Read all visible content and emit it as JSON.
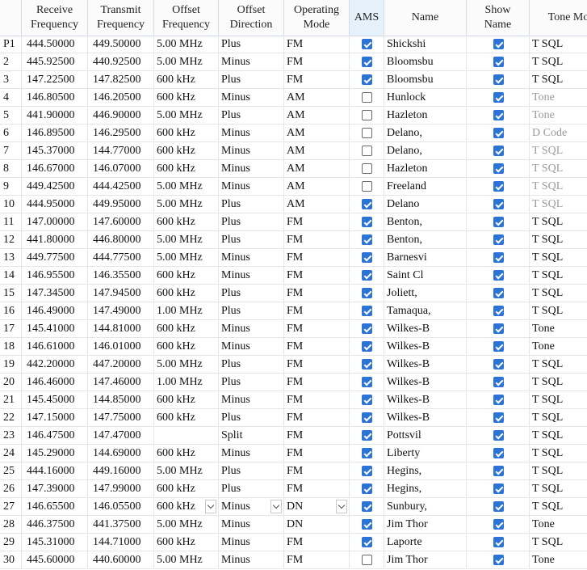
{
  "columns": [
    {
      "key": "row",
      "label": ""
    },
    {
      "key": "rx",
      "label": "Receive\nFrequency"
    },
    {
      "key": "tx",
      "label": "Transmit\nFrequency"
    },
    {
      "key": "off",
      "label": "Offset\nFrequency"
    },
    {
      "key": "dir",
      "label": "Offset\nDirection"
    },
    {
      "key": "mode",
      "label": "Operating\nMode"
    },
    {
      "key": "ams",
      "label": "AMS"
    },
    {
      "key": "name",
      "label": "Name"
    },
    {
      "key": "show",
      "label": "Show\nName"
    },
    {
      "key": "tone",
      "label": "Tone Mod"
    }
  ],
  "colors": {
    "accent": "#2b74d6",
    "header_bg": "#fbfbfb",
    "ams_header_bg": "#e5f1fb",
    "dim_text": "#9a9a9a"
  },
  "rows": [
    {
      "row": "P1",
      "rx": "444.50000",
      "tx": "449.50000",
      "off": "5.00 MHz",
      "dir": "Plus",
      "mode": "FM",
      "ams": true,
      "name": "Shickshi",
      "show": true,
      "tone": "T SQL",
      "tone_dim": false
    },
    {
      "row": "2",
      "rx": "445.92500",
      "tx": "440.92500",
      "off": "5.00 MHz",
      "dir": "Minus",
      "mode": "FM",
      "ams": true,
      "name": "Bloomsbu",
      "show": true,
      "tone": "T SQL",
      "tone_dim": false
    },
    {
      "row": "3",
      "rx": "147.22500",
      "tx": "147.82500",
      "off": "600 kHz",
      "dir": "Plus",
      "mode": "FM",
      "ams": true,
      "name": "Bloomsbu",
      "show": true,
      "tone": "T SQL",
      "tone_dim": false
    },
    {
      "row": "4",
      "rx": "146.80500",
      "tx": "146.20500",
      "off": "600 kHz",
      "dir": "Minus",
      "mode": "AM",
      "ams": false,
      "name": "Hunlock",
      "show": true,
      "tone": "Tone",
      "tone_dim": true
    },
    {
      "row": "5",
      "rx": "441.90000",
      "tx": "446.90000",
      "off": "5.00 MHz",
      "dir": "Plus",
      "mode": "AM",
      "ams": false,
      "name": "Hazleton",
      "show": true,
      "tone": "Tone",
      "tone_dim": true
    },
    {
      "row": "6",
      "rx": "146.89500",
      "tx": "146.29500",
      "off": "600 kHz",
      "dir": "Minus",
      "mode": "AM",
      "ams": false,
      "name": "Delano,",
      "show": true,
      "tone": "D Code",
      "tone_dim": true
    },
    {
      "row": "7",
      "rx": "145.37000",
      "tx": "144.77000",
      "off": "600 kHz",
      "dir": "Minus",
      "mode": "AM",
      "ams": false,
      "name": "Delano,",
      "show": true,
      "tone": "T SQL",
      "tone_dim": true
    },
    {
      "row": "8",
      "rx": "146.67000",
      "tx": "146.07000",
      "off": "600 kHz",
      "dir": "Minus",
      "mode": "AM",
      "ams": false,
      "name": "Hazleton",
      "show": true,
      "tone": "T SQL",
      "tone_dim": true
    },
    {
      "row": "9",
      "rx": "449.42500",
      "tx": "444.42500",
      "off": "5.00 MHz",
      "dir": "Minus",
      "mode": "AM",
      "ams": false,
      "name": "Freeland",
      "show": true,
      "tone": "T SQL",
      "tone_dim": true
    },
    {
      "row": "10",
      "rx": "444.95000",
      "tx": "449.95000",
      "off": "5.00 MHz",
      "dir": "Plus",
      "mode": "AM",
      "ams": true,
      "name": "Delano",
      "show": true,
      "tone": "T SQL",
      "tone_dim": true
    },
    {
      "row": "11",
      "rx": "147.00000",
      "tx": "147.60000",
      "off": "600 kHz",
      "dir": "Plus",
      "mode": "FM",
      "ams": true,
      "name": "Benton,",
      "show": true,
      "tone": "T SQL",
      "tone_dim": false
    },
    {
      "row": "12",
      "rx": "441.80000",
      "tx": "446.80000",
      "off": "5.00 MHz",
      "dir": "Plus",
      "mode": "FM",
      "ams": true,
      "name": "Benton,",
      "show": true,
      "tone": "T SQL",
      "tone_dim": false
    },
    {
      "row": "13",
      "rx": "449.77500",
      "tx": "444.77500",
      "off": "5.00 MHz",
      "dir": "Minus",
      "mode": "FM",
      "ams": true,
      "name": "Barnesvi",
      "show": true,
      "tone": "T SQL",
      "tone_dim": false
    },
    {
      "row": "14",
      "rx": "146.95500",
      "tx": "146.35500",
      "off": "600 kHz",
      "dir": "Minus",
      "mode": "FM",
      "ams": true,
      "name": "Saint Cl",
      "show": true,
      "tone": "T SQL",
      "tone_dim": false
    },
    {
      "row": "15",
      "rx": "147.34500",
      "tx": "147.94500",
      "off": "600 kHz",
      "dir": "Plus",
      "mode": "FM",
      "ams": true,
      "name": "Joliett,",
      "show": true,
      "tone": "T SQL",
      "tone_dim": false
    },
    {
      "row": "16",
      "rx": "146.49000",
      "tx": "147.49000",
      "off": "1.00 MHz",
      "dir": "Plus",
      "mode": "FM",
      "ams": true,
      "name": "Tamaqua,",
      "show": true,
      "tone": "T SQL",
      "tone_dim": false
    },
    {
      "row": "17",
      "rx": "145.41000",
      "tx": "144.81000",
      "off": "600 kHz",
      "dir": "Minus",
      "mode": "FM",
      "ams": true,
      "name": "Wilkes-B",
      "show": true,
      "tone": "Tone",
      "tone_dim": false
    },
    {
      "row": "18",
      "rx": "146.61000",
      "tx": "146.01000",
      "off": "600 kHz",
      "dir": "Minus",
      "mode": "FM",
      "ams": true,
      "name": "Wilkes-B",
      "show": true,
      "tone": "Tone",
      "tone_dim": false
    },
    {
      "row": "19",
      "rx": "442.20000",
      "tx": "447.20000",
      "off": "5.00 MHz",
      "dir": "Plus",
      "mode": "FM",
      "ams": true,
      "name": "Wilkes-B",
      "show": true,
      "tone": "T SQL",
      "tone_dim": false
    },
    {
      "row": "20",
      "rx": "146.46000",
      "tx": "147.46000",
      "off": "1.00 MHz",
      "dir": "Plus",
      "mode": "FM",
      "ams": true,
      "name": "Wilkes-B",
      "show": true,
      "tone": "T SQL",
      "tone_dim": false
    },
    {
      "row": "21",
      "rx": "145.45000",
      "tx": "144.85000",
      "off": "600 kHz",
      "dir": "Minus",
      "mode": "FM",
      "ams": true,
      "name": "Wilkes-B",
      "show": true,
      "tone": "T SQL",
      "tone_dim": false
    },
    {
      "row": "22",
      "rx": "147.15000",
      "tx": "147.75000",
      "off": "600 kHz",
      "dir": "Plus",
      "mode": "FM",
      "ams": true,
      "name": "Wilkes-B",
      "show": true,
      "tone": "T SQL",
      "tone_dim": false
    },
    {
      "row": "23",
      "rx": "146.47500",
      "tx": "147.47000",
      "off": "",
      "dir": "Split",
      "mode": "FM",
      "ams": true,
      "name": "Pottsvil",
      "show": true,
      "tone": "T SQL",
      "tone_dim": false
    },
    {
      "row": "24",
      "rx": "145.29000",
      "tx": "144.69000",
      "off": "600 kHz",
      "dir": "Minus",
      "mode": "FM",
      "ams": true,
      "name": "Liberty",
      "show": true,
      "tone": "T SQL",
      "tone_dim": false
    },
    {
      "row": "25",
      "rx": "444.16000",
      "tx": "449.16000",
      "off": "5.00 MHz",
      "dir": "Plus",
      "mode": "FM",
      "ams": true,
      "name": "Hegins,",
      "show": true,
      "tone": "T SQL",
      "tone_dim": false
    },
    {
      "row": "26",
      "rx": "147.39000",
      "tx": "147.99000",
      "off": "600 kHz",
      "dir": "Plus",
      "mode": "FM",
      "ams": true,
      "name": "Hegins,",
      "show": true,
      "tone": "T SQL",
      "tone_dim": false
    },
    {
      "row": "27",
      "rx": "146.65500",
      "tx": "146.05500",
      "off": "600 kHz",
      "dir": "Minus",
      "mode": "DN",
      "ams": true,
      "name": "Sunbury,",
      "show": true,
      "tone": "T SQL",
      "tone_dim": false,
      "editing": true
    },
    {
      "row": "28",
      "rx": "446.37500",
      "tx": "441.37500",
      "off": "5.00 MHz",
      "dir": "Minus",
      "mode": "DN",
      "ams": true,
      "name": "Jim Thor",
      "show": true,
      "tone": "Tone",
      "tone_dim": false
    },
    {
      "row": "29",
      "rx": "145.31000",
      "tx": "144.71000",
      "off": "600 kHz",
      "dir": "Minus",
      "mode": "FM",
      "ams": true,
      "name": "Laporte",
      "show": true,
      "tone": "T SQL",
      "tone_dim": false
    },
    {
      "row": "30",
      "rx": "445.60000",
      "tx": "440.60000",
      "off": "5.00 MHz",
      "dir": "Minus",
      "mode": "FM",
      "ams": false,
      "name": "Jim Thor",
      "show": true,
      "tone": "Tone",
      "tone_dim": false
    }
  ]
}
